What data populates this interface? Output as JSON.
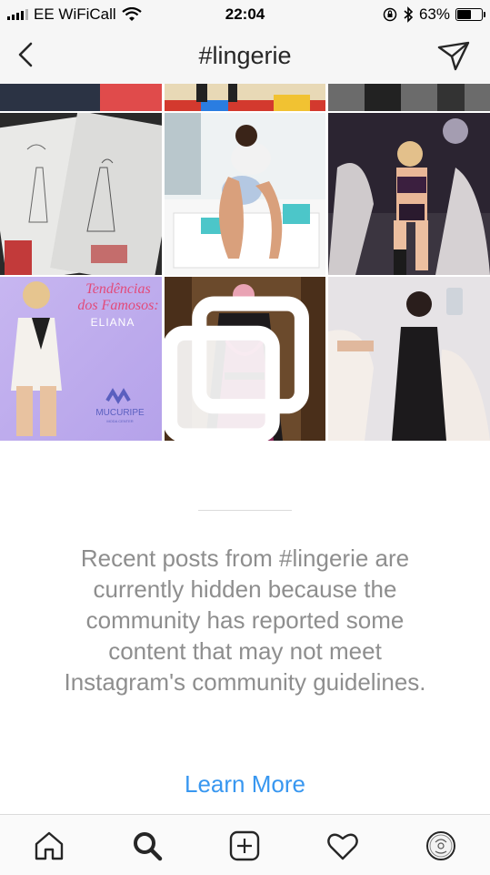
{
  "status_bar": {
    "carrier": "EE WiFiCall",
    "time": "22:04",
    "battery": "63%",
    "battery_level": 0.63
  },
  "header": {
    "title": "#lingerie",
    "back_icon": "chevron-left-icon",
    "direct_icon": "paper-plane-icon"
  },
  "grid": {
    "tiles": [
      {
        "caption_line1": "Tendências",
        "caption_line2": "dos Famosos:",
        "caption_line3": "ELIANA",
        "brand": "MUCURIPE",
        "brand_sub": "MODA CENTER"
      }
    ]
  },
  "notice": {
    "text": "Recent posts from #lingerie are currently hidden because the community has reported some content that may not meet Instagram's community guidelines.",
    "link": "Learn More"
  },
  "tabbar": {
    "items": [
      "home-icon",
      "search-icon",
      "new-post-icon",
      "activity-heart-icon",
      "profile-icon"
    ]
  },
  "colors": {
    "accent": "#3897f0",
    "muted_text": "#8e8e8e",
    "bar_bg": "#f6f6f6"
  }
}
